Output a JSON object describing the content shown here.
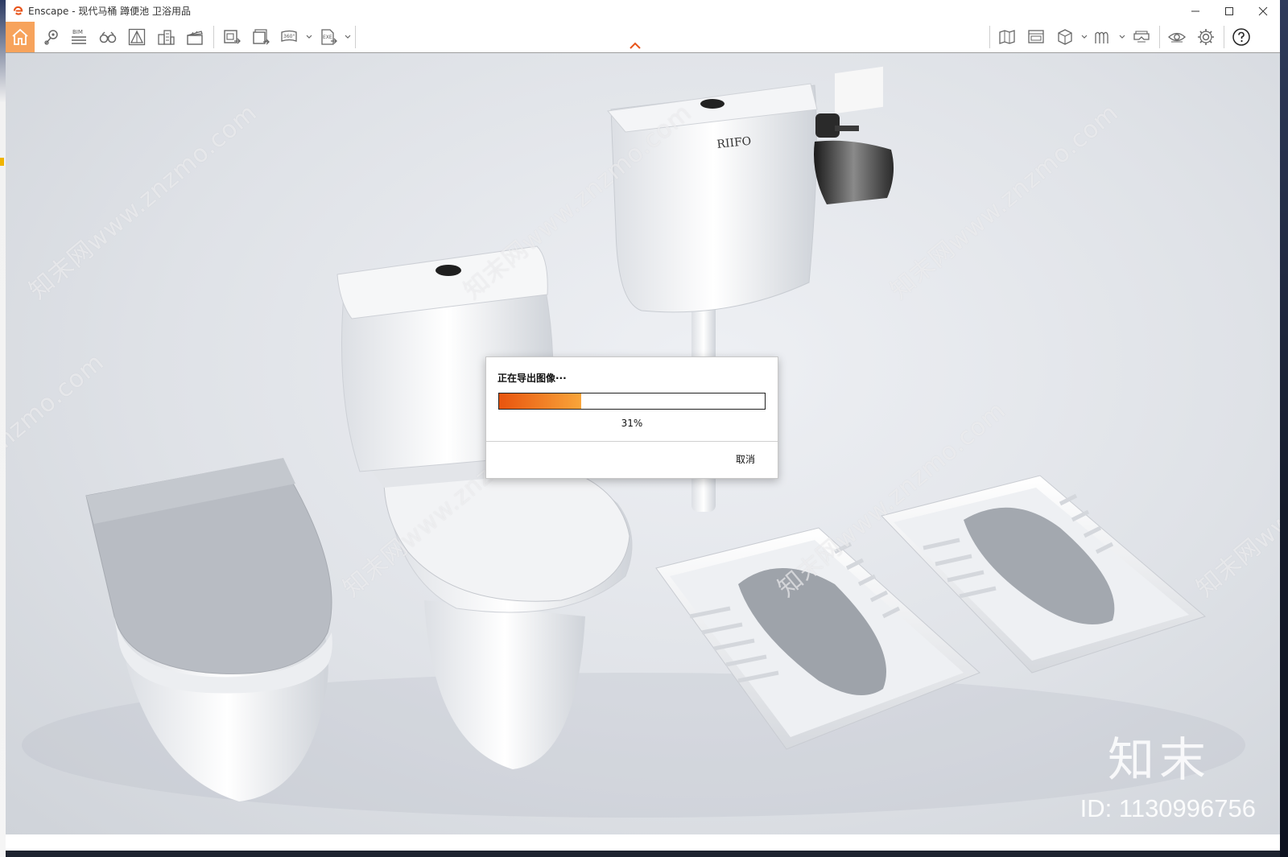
{
  "window": {
    "title": "Enscape - 现代马桶 蹲便池 卫浴用品"
  },
  "toolbar": {
    "left_icons": [
      "home-icon",
      "location-pin-icon",
      "bim-icon",
      "binoculars-icon",
      "perspective-icon",
      "buildings-icon",
      "clapper-icon",
      "screenshot-export-icon",
      "batch-render-icon",
      "panorama-360-icon",
      "exe-export-icon"
    ],
    "right_icons": [
      "map-icon",
      "video-editor-icon",
      "asset-library-icon",
      "material-editor-icon",
      "vr-headset-icon",
      "visual-settings-icon",
      "settings-gear-icon",
      "help-icon"
    ],
    "bim_label": "BIM",
    "pano_label": "360°",
    "exe_label": "EXE",
    "accent_color": "#f7a35c"
  },
  "viewport": {
    "brand_on_tank": "RIIFO",
    "watermark_text": "知末网www.znzmo.com",
    "corner_logo": "知末",
    "corner_id": "ID: 1130996756"
  },
  "dialog": {
    "title": "正在导出图像···",
    "progress_percent": 31,
    "progress_label": "31%",
    "cancel_label": "取消",
    "progress_color_start": "#e8540e",
    "progress_color_end": "#f9a53a"
  }
}
